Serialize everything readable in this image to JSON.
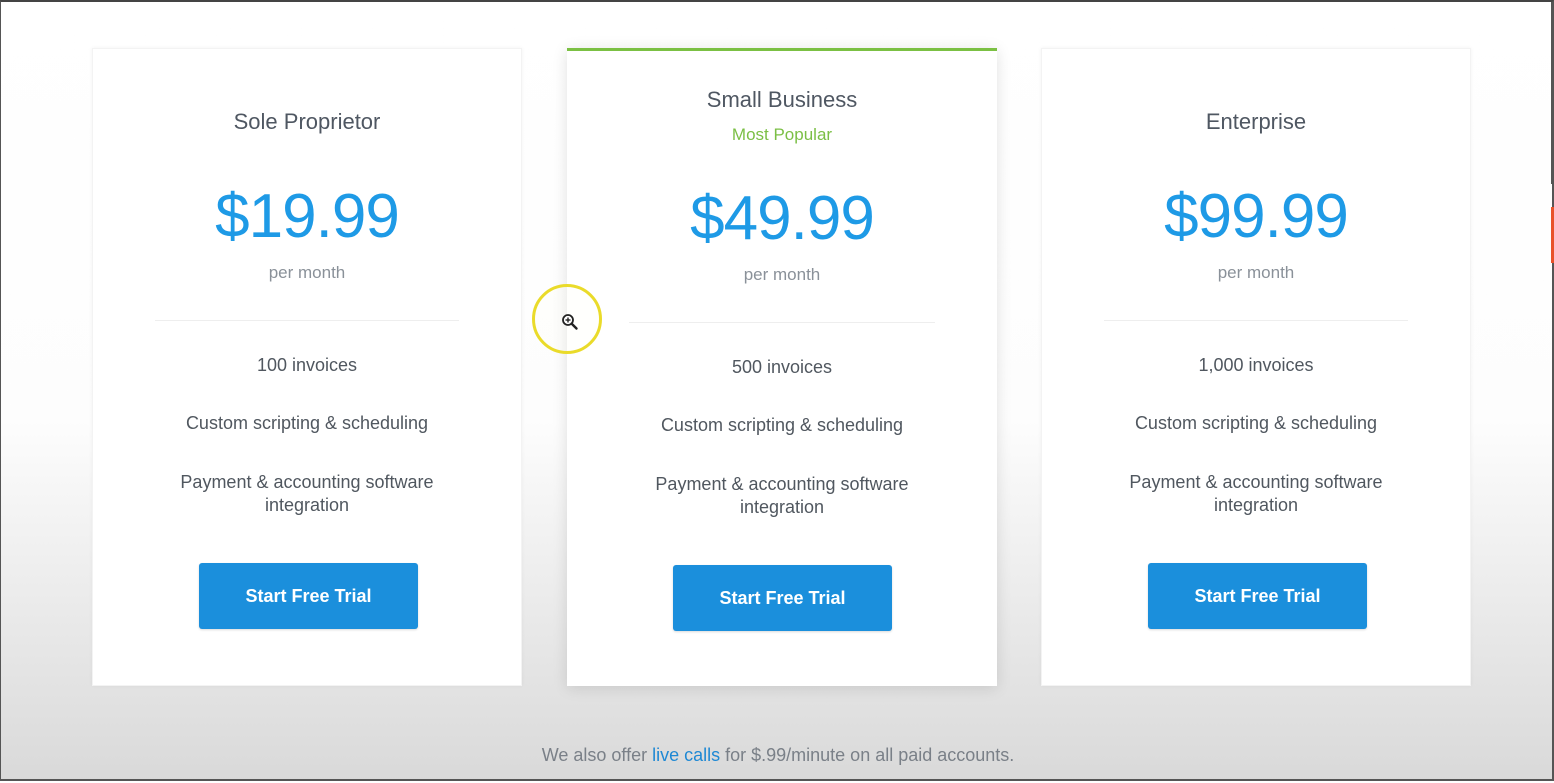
{
  "plans": [
    {
      "name": "Sole Proprietor",
      "badge": "",
      "price": "$19.99",
      "period": "per month",
      "features": [
        "100 invoices",
        "Custom scripting & scheduling",
        "Payment & accounting software integration"
      ],
      "cta": "Start Free Trial"
    },
    {
      "name": "Small Business",
      "badge": "Most Popular",
      "price": "$49.99",
      "period": "per month",
      "features": [
        "500 invoices",
        "Custom scripting & scheduling",
        "Payment & accounting software integration"
      ],
      "cta": "Start Free Trial"
    },
    {
      "name": "Enterprise",
      "badge": "",
      "price": "$99.99",
      "period": "per month",
      "features": [
        "1,000 invoices",
        "Custom scripting & scheduling",
        "Payment & accounting software integration"
      ],
      "cta": "Start Free Trial"
    }
  ],
  "footnote": {
    "prefix": "We also offer ",
    "link": "live calls",
    "suffix": " for $.99/minute on all paid accounts."
  },
  "colors": {
    "price": "#1e9ae6",
    "button": "#1b8fdc",
    "popular": "#7bbf45",
    "featured_border": "#7bc043",
    "cursor_ring": "#eadb2a"
  },
  "icons": {
    "cursor": "zoom-in-icon"
  }
}
